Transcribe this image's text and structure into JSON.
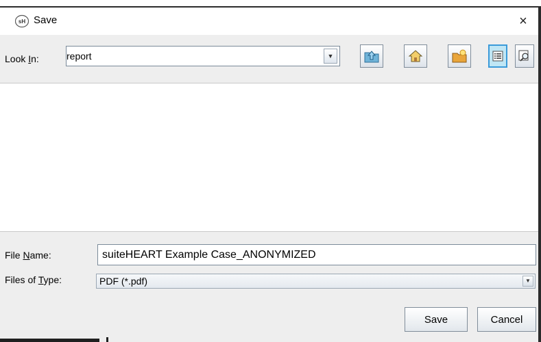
{
  "window": {
    "title": "Save",
    "app_icon_text": "sH",
    "close_glyph": "×"
  },
  "lookin": {
    "label_pre": "Look ",
    "label_mnemonic": "I",
    "label_post": "n:",
    "value": "report",
    "dropdown_arrow": "▼"
  },
  "toolbar": {
    "icons": [
      "up-one-level-icon",
      "home-icon",
      "new-folder-icon",
      "list-view-icon",
      "details-view-icon"
    ],
    "active": "list-view-icon"
  },
  "filename": {
    "label_pre": "File ",
    "label_mnemonic": "N",
    "label_post": "ame:",
    "value": "suiteHEART Example Case_ANONYMIZED"
  },
  "filetype": {
    "label_pre": "Files of ",
    "label_mnemonic": "T",
    "label_post": "ype:",
    "value": "PDF (*.pdf)",
    "dropdown_arrow": "▼"
  },
  "buttons": {
    "save": "Save",
    "cancel": "Cancel"
  },
  "colors": {
    "accent": "#3a9ad9",
    "panel": "#eeeeee"
  }
}
